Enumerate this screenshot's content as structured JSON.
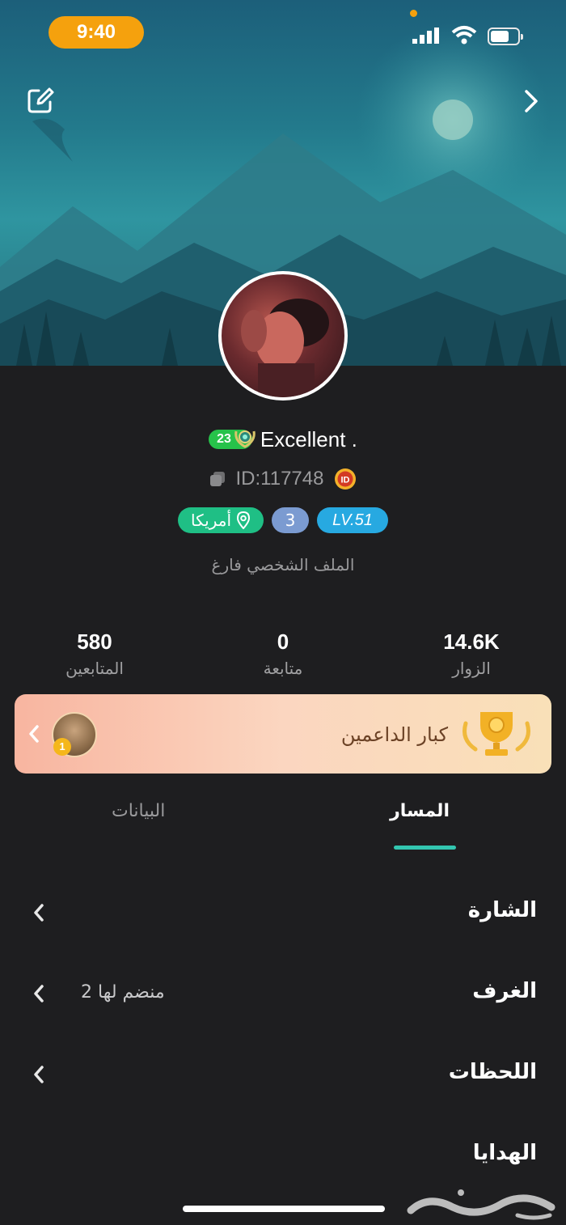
{
  "status_bar": {
    "time": "9:40",
    "battery_level": 0.7
  },
  "header": {
    "edit_icon": "edit-square-icon",
    "next_icon": "chevron-right-icon"
  },
  "profile": {
    "level_badge": "23",
    "name": "Excellent .",
    "id_text": "ID:117748",
    "country": "أمريكا",
    "count_tag": "3",
    "lv_tag": "LV.51",
    "bio": "الملف الشخصي فارغ"
  },
  "stats": [
    {
      "value": "14.6K",
      "label": "الزوار"
    },
    {
      "value": "0",
      "label": "متابعة"
    },
    {
      "value": "580",
      "label": "المتابعين"
    }
  ],
  "supporters": {
    "title": "كبار الداعمين",
    "rank": "1"
  },
  "tabs": [
    {
      "label": "المسار",
      "active": true
    },
    {
      "label": "البيانات",
      "active": false
    }
  ],
  "list": [
    {
      "label": "الشارة",
      "value": ""
    },
    {
      "label": "الغرف",
      "value": "2 منضم لها"
    },
    {
      "label": "اللحظات",
      "value": ""
    },
    {
      "label": "الهدايا",
      "value": ""
    }
  ],
  "colors": {
    "accent_tab": "#33c6b0",
    "time_pill": "#f5a10d",
    "country_tag": "#1fbf85",
    "lv_tag": "#27a9e1",
    "level_badge": "#27c24a"
  }
}
